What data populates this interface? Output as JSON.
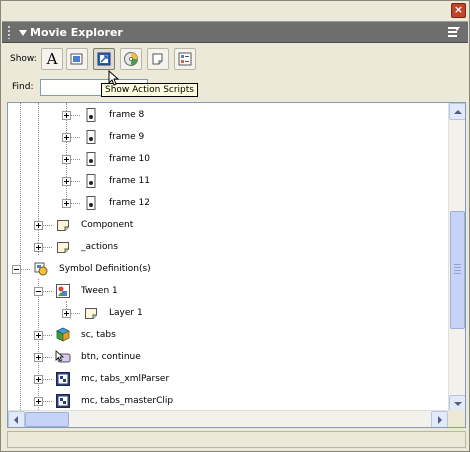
{
  "panel": {
    "title": "Movie Explorer",
    "close_glyph": "×"
  },
  "toolbar": {
    "show_label": "Show:",
    "buttons": [
      {
        "name": "show-text-button",
        "icon": "text-A-icon",
        "glyph": "A"
      },
      {
        "name": "show-buttons-movieclips-graphics-button",
        "icon": "movieclip-icon"
      },
      {
        "name": "show-action-scripts-button",
        "icon": "actionscript-icon"
      },
      {
        "name": "show-video-sounds-bitmaps-button",
        "icon": "media-disc-icon"
      },
      {
        "name": "show-frames-layers-button",
        "icon": "frames-layers-icon"
      },
      {
        "name": "customize-items-to-show-button",
        "icon": "customize-icon"
      }
    ],
    "tooltip": "Show Action Scripts"
  },
  "find": {
    "label": "Find:",
    "value": "",
    "placeholder": ""
  },
  "tree": {
    "items": [
      {
        "label": "frame 8",
        "icon": "frame-icon",
        "expander": "plus"
      },
      {
        "label": "frame 9",
        "icon": "frame-icon",
        "expander": "plus"
      },
      {
        "label": "frame 10",
        "icon": "frame-icon",
        "expander": "plus"
      },
      {
        "label": "frame 11",
        "icon": "frame-icon",
        "expander": "plus"
      },
      {
        "label": "frame 12",
        "icon": "frame-icon",
        "expander": "plus"
      },
      {
        "label": "Component",
        "icon": "layer-icon",
        "expander": "plus"
      },
      {
        "label": "_actions",
        "icon": "layer-icon",
        "expander": "plus"
      },
      {
        "label": "Symbol Definition(s)",
        "icon": "symbol-definitions-icon",
        "expander": "minus"
      },
      {
        "label": "Tween 1",
        "icon": "graphic-symbol-icon",
        "expander": "minus"
      },
      {
        "label": "Layer 1",
        "icon": "layer-icon",
        "expander": "plus"
      },
      {
        "label": "sc, tabs",
        "icon": "component-icon",
        "expander": "plus"
      },
      {
        "label": "btn, continue",
        "icon": "button-symbol-icon",
        "expander": "plus"
      },
      {
        "label": "mc, tabs_xmlParser",
        "icon": "movieclip-symbol-icon",
        "expander": "plus"
      },
      {
        "label": "mc, tabs_masterClip",
        "icon": "movieclip-symbol-icon",
        "expander": "plus"
      }
    ]
  },
  "scrollbars": {
    "vertical_thumb_fraction": 0.38,
    "horizontal_thumb_fraction": 0.11
  },
  "colors": {
    "panel_header": "#6e6e6e",
    "window_bg": "#ece9d8",
    "tooltip_bg": "#ffffe1",
    "scroll_thumb": "#c6d3f7"
  }
}
